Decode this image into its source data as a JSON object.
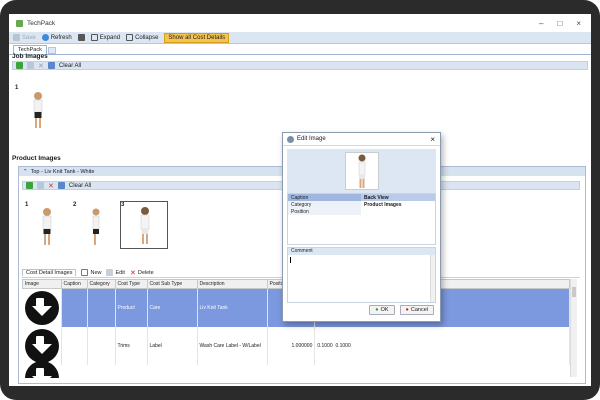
{
  "window": {
    "title": "TechPack"
  },
  "toolbar": {
    "save": "Save",
    "refresh": "Refresh",
    "expand": "Expand",
    "collapse": "Collapse",
    "show_all": "Show all Cost Details"
  },
  "tabs": {
    "techpack": "TechPack"
  },
  "job_images": {
    "title": "Job Images",
    "clear_all": "Clear All",
    "items": [
      {
        "number": "1"
      }
    ]
  },
  "product_images": {
    "title": "Product Images",
    "group": "Top - Liv Knit Tank - White",
    "clear_all": "Clear All",
    "items": [
      {
        "number": "1"
      },
      {
        "number": "2"
      },
      {
        "number": "3"
      }
    ]
  },
  "cost_detail": {
    "tab": "Cost Detail Images",
    "new": "New",
    "edit": "Edit",
    "delete": "Delete",
    "columns": [
      "Image",
      "Caption",
      "Category",
      "Cost Type",
      "Cost Sub Type",
      "Description",
      "Position"
    ],
    "rows": [
      {
        "cost_type": "Product",
        "cost_sub_type": "Care",
        "description": "Liv Knit Tank",
        "v1": "",
        "v2": "",
        "v3": ""
      },
      {
        "cost_type": "Trims",
        "cost_sub_type": "Label",
        "description": "Wash Care Label - W/Label",
        "v1": "1.000000",
        "v2": "0.1000",
        "v3": "0.1000"
      }
    ]
  },
  "edit_image": {
    "title": "Edit Image",
    "props": [
      {
        "name": "Caption",
        "value": "Back View"
      },
      {
        "name": "Category",
        "value": "Product Images"
      },
      {
        "name": "Position",
        "value": ""
      }
    ],
    "comment_label": "Comment",
    "ok": "OK",
    "cancel": "Cancel"
  }
}
